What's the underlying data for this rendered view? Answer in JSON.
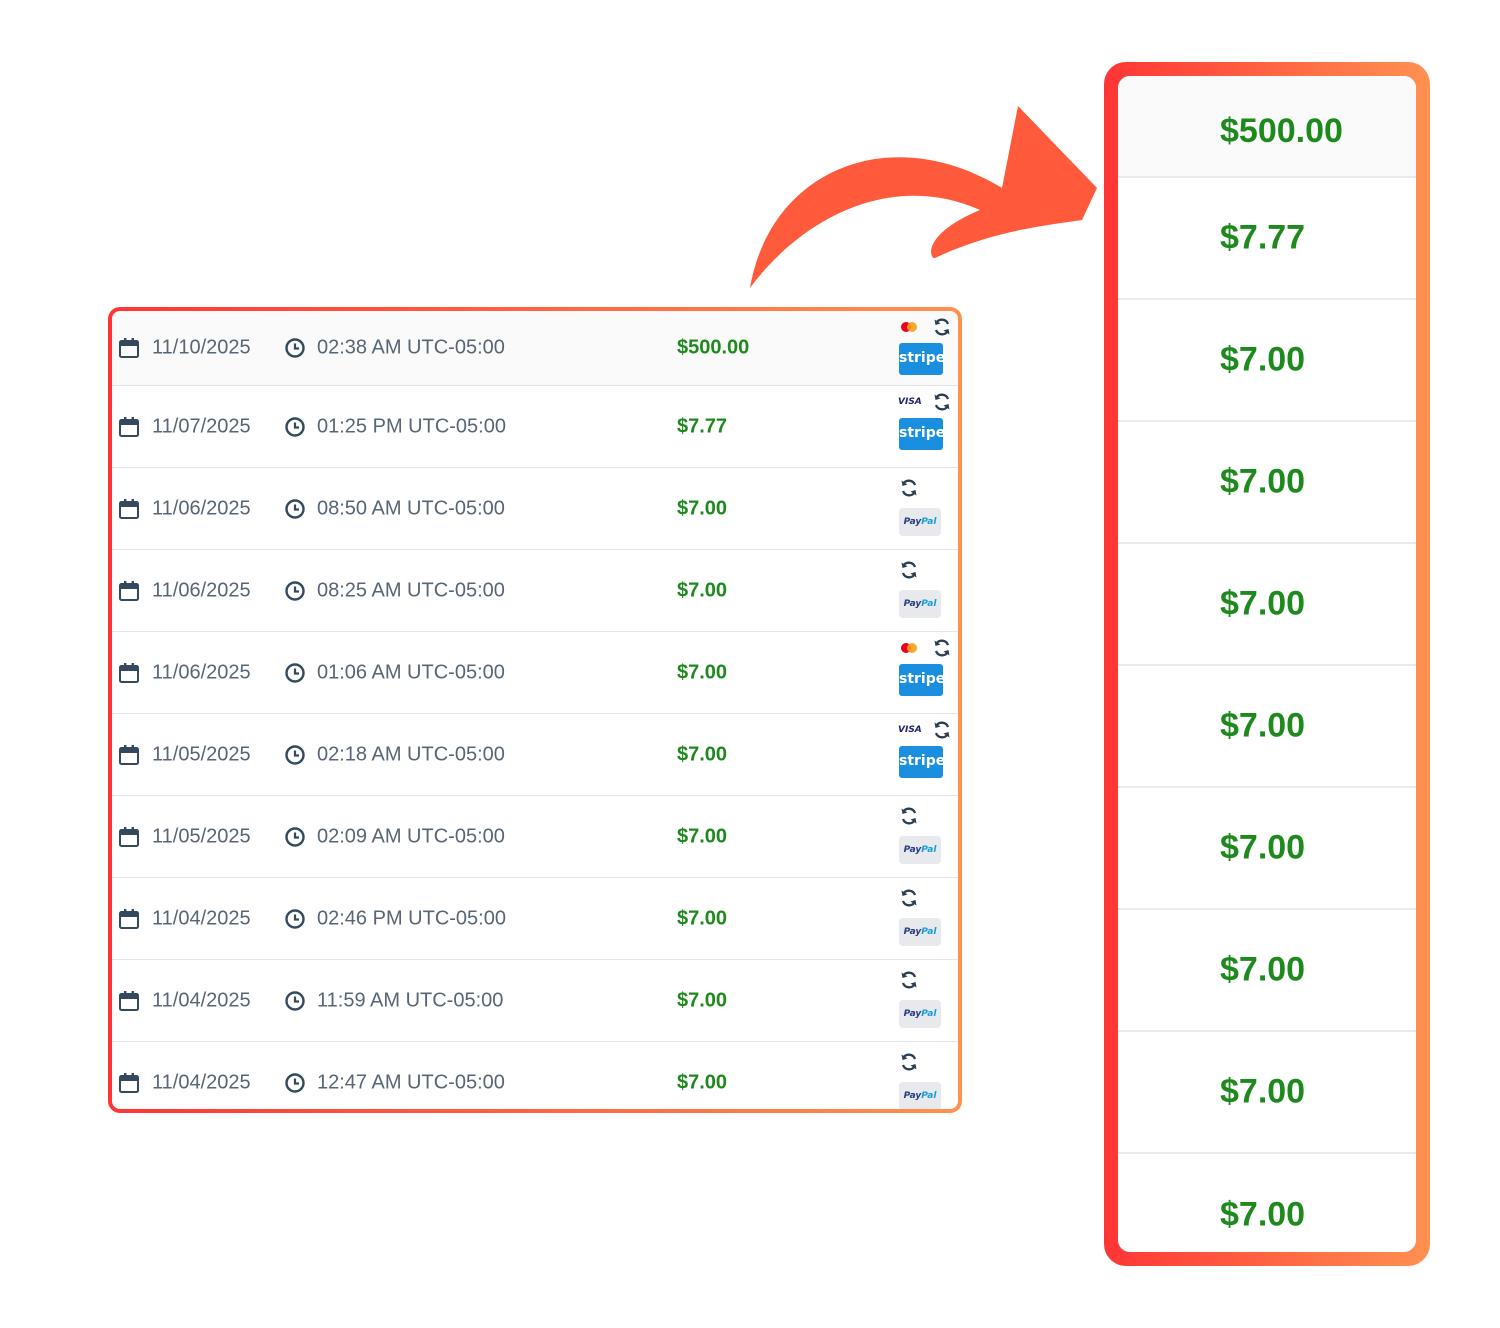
{
  "colors": {
    "amount_green": "#1e8a1e",
    "text_gray": "#576574",
    "frame_gradient_start": "#ff3535",
    "frame_gradient_end": "#ff9150",
    "arrow": "#ff5a3c",
    "stripe_blue": "#1a8fe0"
  },
  "transactions": [
    {
      "date": "11/10/2025",
      "time": "02:38 AM UTC-05:00",
      "amount": "$500.00",
      "method": "stripe",
      "stripe_label": "stripe",
      "card": "mastercard-icon"
    },
    {
      "date": "11/07/2025",
      "time": "01:25 PM UTC-05:00",
      "amount": "$7.77",
      "method": "stripe",
      "stripe_label": "stripe",
      "card": "visa-icon",
      "card_label": "VISA"
    },
    {
      "date": "11/06/2025",
      "time": "08:50 AM UTC-05:00",
      "amount": "$7.00",
      "method": "paypal",
      "paypal_a": "Pay",
      "paypal_b": "Pal"
    },
    {
      "date": "11/06/2025",
      "time": "08:25 AM UTC-05:00",
      "amount": "$7.00",
      "method": "paypal",
      "paypal_a": "Pay",
      "paypal_b": "Pal"
    },
    {
      "date": "11/06/2025",
      "time": "01:06 AM UTC-05:00",
      "amount": "$7.00",
      "method": "stripe",
      "stripe_label": "stripe",
      "card": "mastercard-icon"
    },
    {
      "date": "11/05/2025",
      "time": "02:18 AM UTC-05:00",
      "amount": "$7.00",
      "method": "stripe",
      "stripe_label": "stripe",
      "card": "visa-icon",
      "card_label": "VISA"
    },
    {
      "date": "11/05/2025",
      "time": "02:09 AM UTC-05:00",
      "amount": "$7.00",
      "method": "paypal",
      "paypal_a": "Pay",
      "paypal_b": "Pal"
    },
    {
      "date": "11/04/2025",
      "time": "02:46 PM UTC-05:00",
      "amount": "$7.00",
      "method": "paypal",
      "paypal_a": "Pay",
      "paypal_b": "Pal"
    },
    {
      "date": "11/04/2025",
      "time": "11:59 AM UTC-05:00",
      "amount": "$7.00",
      "method": "paypal",
      "paypal_a": "Pay",
      "paypal_b": "Pal"
    },
    {
      "date": "11/04/2025",
      "time": "12:47 AM UTC-05:00",
      "amount": "$7.00",
      "method": "paypal",
      "paypal_a": "Pay",
      "paypal_b": "Pal"
    }
  ],
  "zoom_amounts": [
    "$500.00",
    "$7.77",
    "$7.00",
    "$7.00",
    "$7.00",
    "$7.00",
    "$7.00",
    "$7.00",
    "$7.00",
    "$7.00"
  ],
  "icons": {
    "date": "calendar-icon",
    "time": "clock-icon",
    "recurring": "refresh-icon",
    "pointer": "curved-arrow-icon"
  }
}
